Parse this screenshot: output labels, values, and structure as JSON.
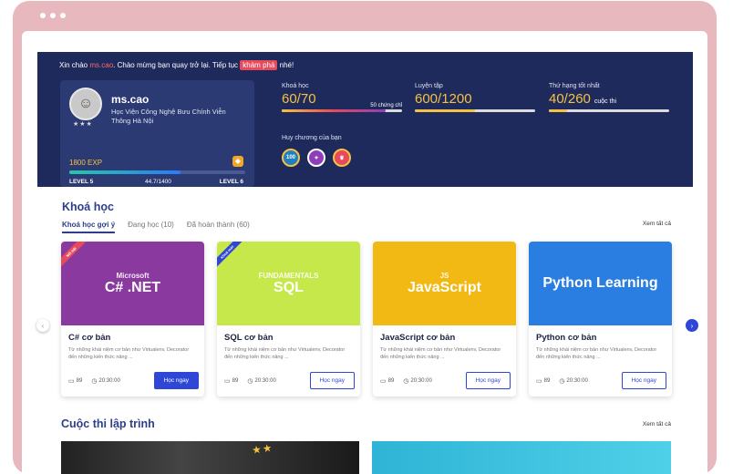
{
  "hero": {
    "greeting_pre": "Xin chào ",
    "username_inline": "ms.cao",
    "greeting_mid": ". Chào mừng bạn quay trở lại. Tiếp tục ",
    "explore": "khám phá",
    "greeting_post": " nhé!",
    "profile": {
      "name": "ms.cao",
      "university": "Học Viện Công Nghệ Bưu Chính Viễn Thông Hà Nội",
      "exp": "1800 EXP",
      "exp_progress": 0.63,
      "level_current": "LEVEL 5",
      "level_progress": "44.7/1400",
      "level_next": "LEVEL 6"
    },
    "stats": [
      {
        "label": "Khoá học",
        "value": "60/70",
        "sub": "50 chứng chỉ",
        "progress": 0.86,
        "color": "gradient"
      },
      {
        "label": "Luyện tập",
        "value": "600/1200",
        "sub": "",
        "progress": 0.5,
        "color": "#f5c243"
      },
      {
        "label": "Thứ hạng tốt nhất",
        "value": "40/260",
        "unit": "cuộc thi",
        "sub": "",
        "progress": 0.15,
        "color": "#f5c243"
      }
    ],
    "medals_label": "Huy chương của bạn",
    "medals": [
      "100",
      "",
      ""
    ]
  },
  "courses_section": {
    "title": "Khoá học",
    "tabs": [
      "Khoá học gợi ý",
      "Đang học (10)",
      "Đã hoàn thành (60)"
    ],
    "see_all": "Xem tất cả",
    "items": [
      {
        "thumb_title": "C#  .NET",
        "thumb_sub": "Microsoft",
        "bg": "#8a3a9e",
        "ribbon": "Nổi bật",
        "ribbon_color": "#e74a5a",
        "title": "C# cơ bản",
        "desc": "Từ những khái niệm cơ bản như Virtualenv, Decorator đến những kiến thức nâng ...",
        "lessons": "89",
        "time": "20:30:00",
        "button": "Học ngay",
        "primary": true
      },
      {
        "thumb_title": "SQL",
        "thumb_sub": "FUNDAMENTALS",
        "bg": "#c6e84a",
        "ribbon": "Khoá mới",
        "ribbon_color": "#2f47d6",
        "title": "SQL cơ bản",
        "desc": "Từ những khái niệm cơ bản như Virtualenv, Decorator đến những kiến thức nâng ...",
        "lessons": "89",
        "time": "20:30:00",
        "button": "Học ngay",
        "primary": false
      },
      {
        "thumb_title": "JavaScript",
        "thumb_sub": "JS",
        "bg": "#f2b814",
        "ribbon": "",
        "ribbon_color": "",
        "title": "JavaScript cơ bản",
        "desc": "Từ những khái niệm cơ bản như Virtualenv, Decorator đến những kiến thức nâng ...",
        "lessons": "89",
        "time": "20:30:00",
        "button": "Học ngay",
        "primary": false
      },
      {
        "thumb_title": "Python Learning",
        "thumb_sub": "",
        "bg": "#2a7de1",
        "ribbon": "",
        "ribbon_color": "",
        "title": "Python cơ bản",
        "desc": "Từ những khái niệm cơ bản như Virtualenv, Decorator đến những kiến thức nâng ...",
        "lessons": "89",
        "time": "20:30:00",
        "button": "Học ngay",
        "primary": false
      }
    ]
  },
  "contest_section": {
    "title": "Cuộc thi lập trình",
    "see_all": "Xem tất cả"
  }
}
